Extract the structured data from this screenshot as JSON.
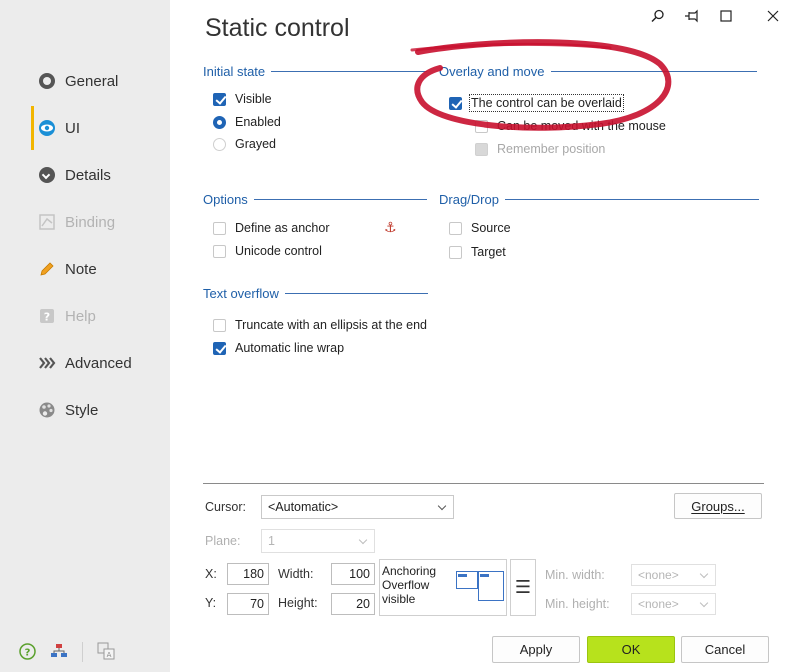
{
  "title": "Static control",
  "sidebar": {
    "items": [
      {
        "label": "General",
        "icon": "circle-icon",
        "state": "normal"
      },
      {
        "label": "UI",
        "icon": "eye-icon",
        "state": "active"
      },
      {
        "label": "Details",
        "icon": "chevron-circle-icon",
        "state": "normal"
      },
      {
        "label": "Binding",
        "icon": "binding-icon",
        "state": "disabled"
      },
      {
        "label": "Note",
        "icon": "pencil-icon",
        "state": "normal"
      },
      {
        "label": "Help",
        "icon": "help-icon",
        "state": "disabled"
      },
      {
        "label": "Advanced",
        "icon": "chevrons-right-icon",
        "state": "normal"
      },
      {
        "label": "Style",
        "icon": "palette-icon",
        "state": "normal"
      }
    ]
  },
  "groups": {
    "initial_state": {
      "title": "Initial state",
      "visible": "Visible",
      "enabled": "Enabled",
      "grayed": "Grayed"
    },
    "overlay": {
      "title": "Overlay and move",
      "overlaid": "The control can be overlaid",
      "moved": "Can be moved with the mouse",
      "remember": "Remember position"
    },
    "options": {
      "title": "Options",
      "anchor": "Define as anchor",
      "unicode": "Unicode control"
    },
    "dragdrop": {
      "title": "Drag/Drop",
      "source": "Source",
      "target": "Target"
    },
    "text_overflow": {
      "title": "Text overflow",
      "truncate": "Truncate with an ellipsis at the end",
      "wrap": "Automatic line wrap"
    }
  },
  "bottom": {
    "cursor_label": "Cursor:",
    "cursor_value": "<Automatic>",
    "groups_button": "Groups...",
    "plane_label": "Plane:",
    "plane_value": "1",
    "x_label": "X:",
    "x_value": "180",
    "y_label": "Y:",
    "y_value": "70",
    "width_label": "Width:",
    "width_value": "100",
    "height_label": "Height:",
    "height_value": "20",
    "anchoring_line1": "Anchoring",
    "anchoring_line2": "Overflow",
    "anchoring_line3": "visible",
    "min_width_label": "Min. width:",
    "min_width_value": "<none>",
    "min_height_label": "Min. height:",
    "min_height_value": "<none>"
  },
  "buttons": {
    "apply": "Apply",
    "ok": "OK",
    "cancel": "Cancel"
  },
  "colors": {
    "accent": "#1f64b5",
    "ok_green": "#b7e21c",
    "annotation_red": "#c8102e",
    "sidebar_active": "#f2b500"
  }
}
